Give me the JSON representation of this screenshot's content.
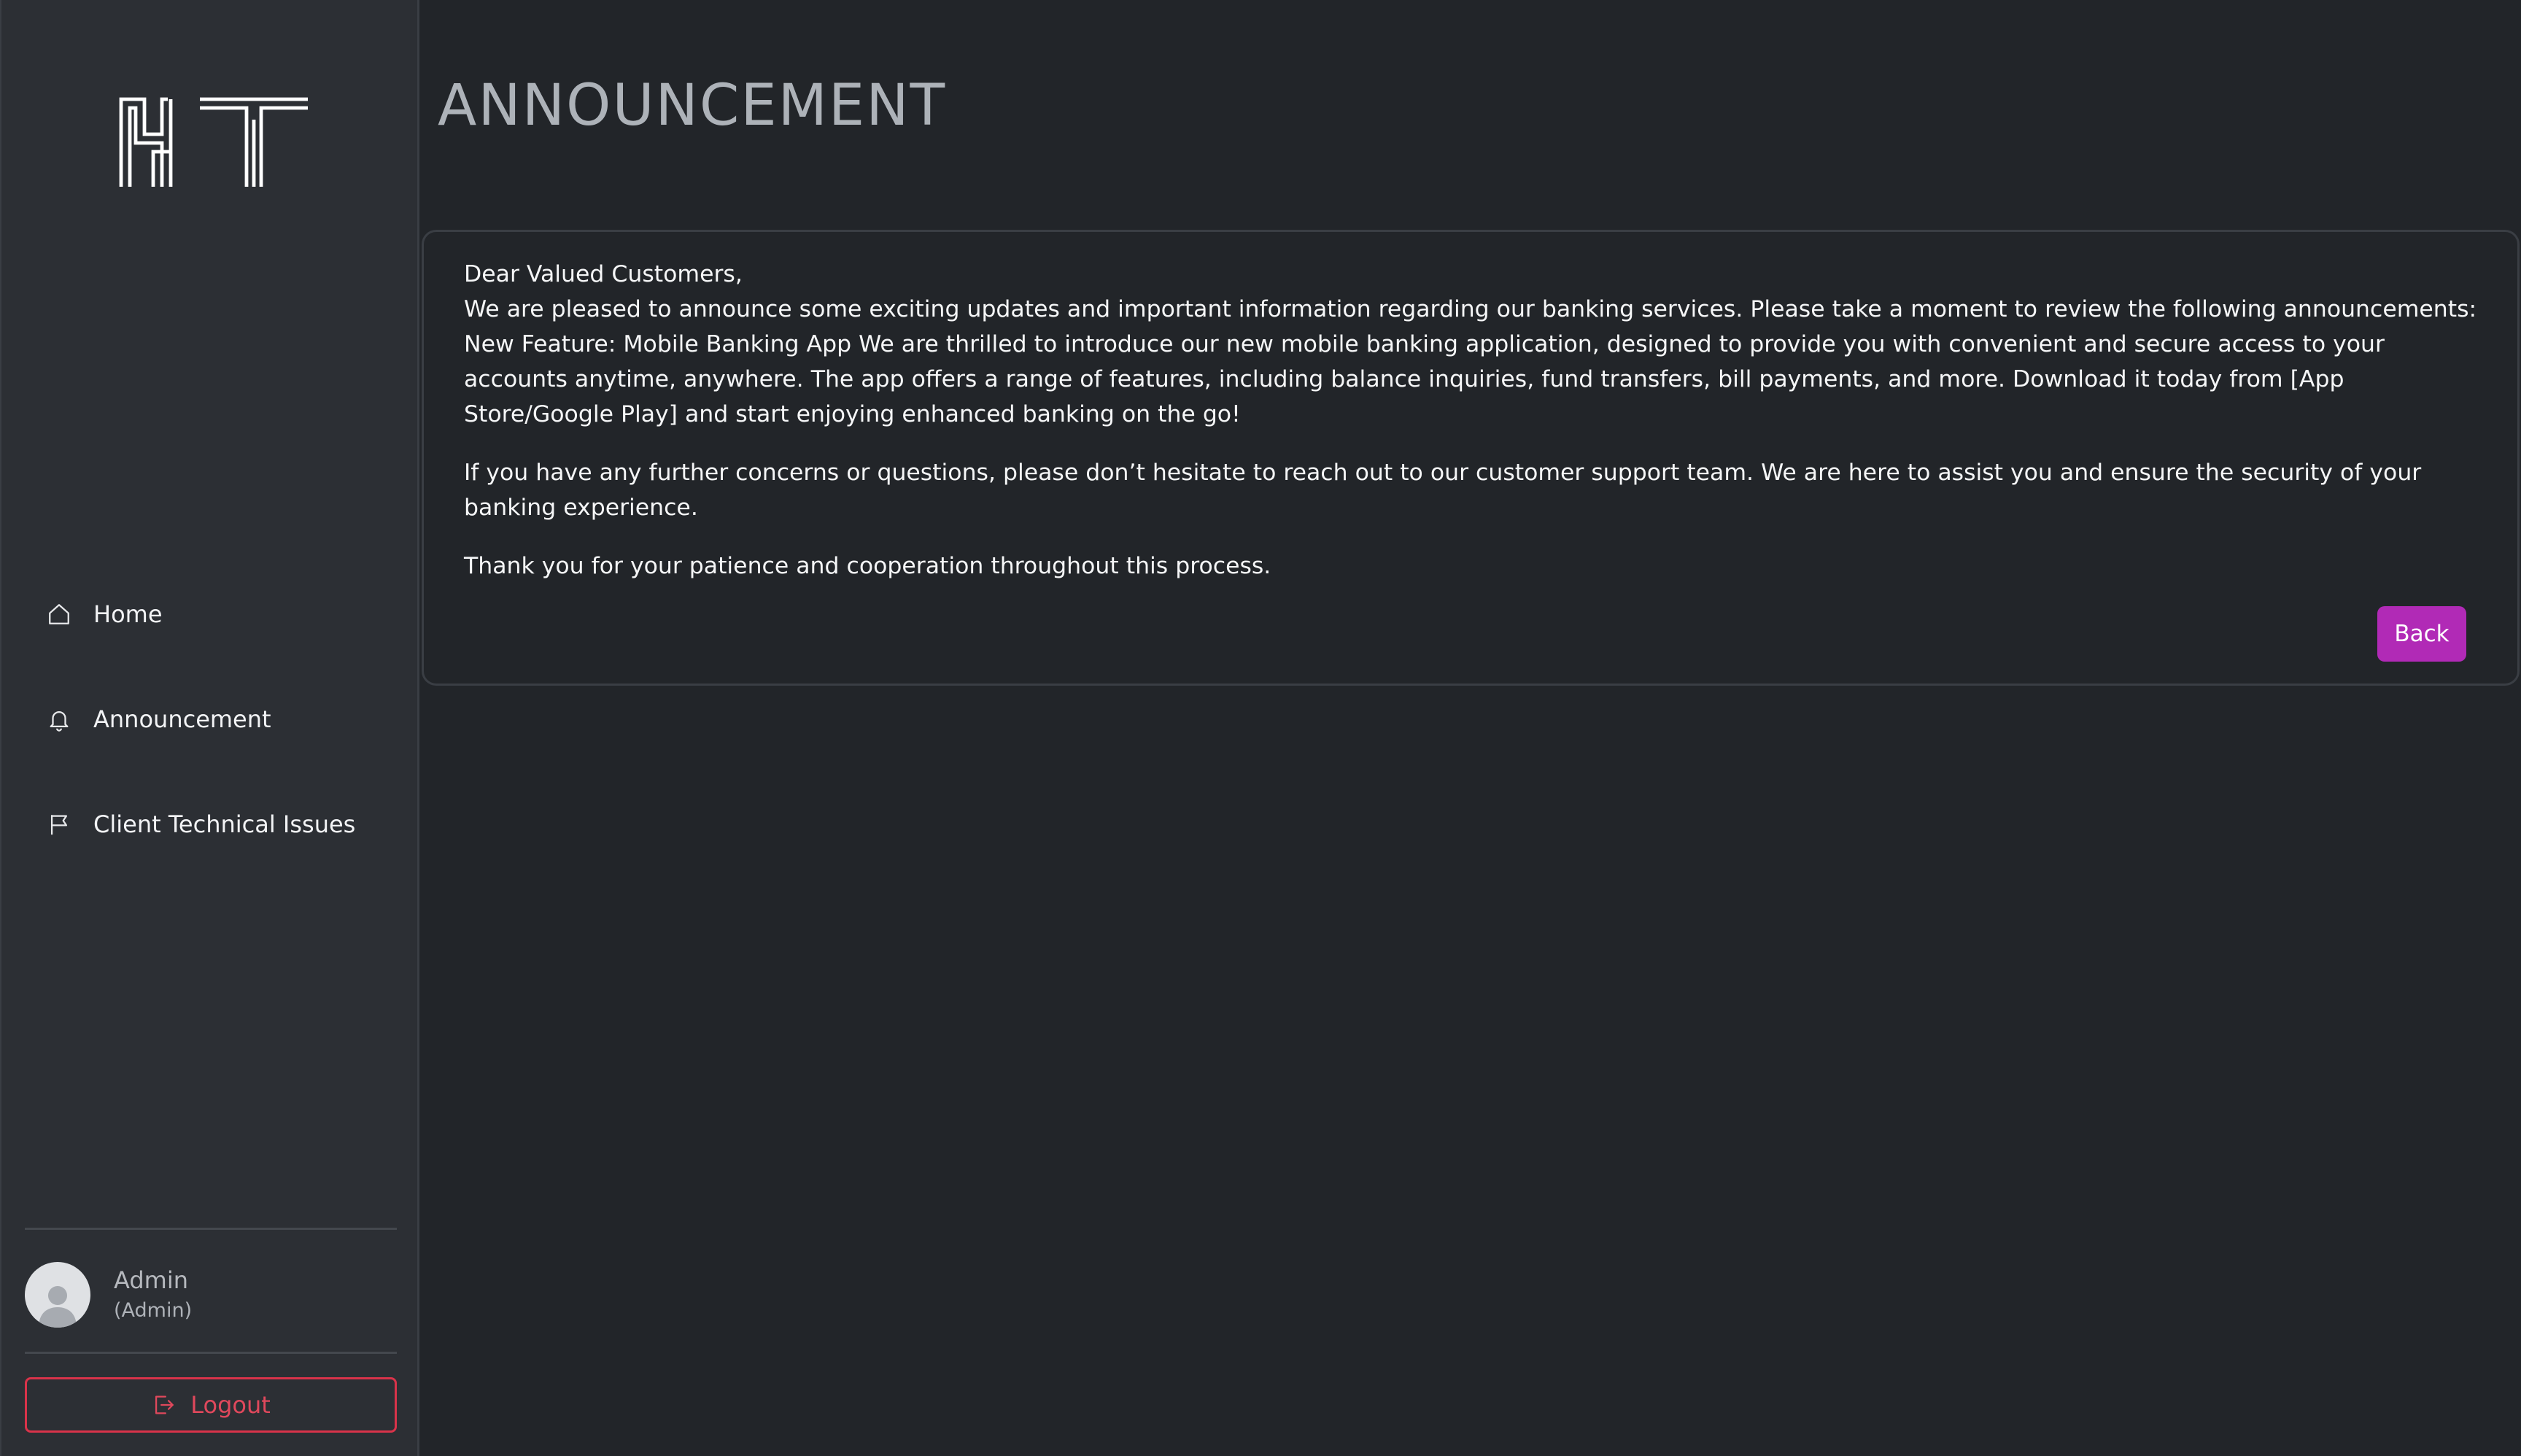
{
  "sidebar": {
    "logo_alt": "NT",
    "nav": [
      {
        "label": "Home",
        "icon": "home-icon"
      },
      {
        "label": "Announcement",
        "icon": "bell-icon"
      },
      {
        "label": "Client Technical Issues",
        "icon": "flag-icon"
      }
    ],
    "user": {
      "name": "Admin",
      "role": "(Admin)"
    },
    "logout_label": "Logout"
  },
  "main": {
    "title": "ANNOUNCEMENT",
    "announcement": {
      "greeting": "Dear Valued Customers,",
      "body": "We are pleased to announce some exciting updates and important information regarding our banking services. Please take a moment to review the following announcements: New Feature: Mobile Banking App We are thrilled to introduce our new mobile banking application, designed to provide you with convenient and secure access to your accounts anytime, anywhere. The app offers a range of features, including balance inquiries, fund transfers, bill payments, and more. Download it today from [App Store/Google Play] and start enjoying enhanced banking on the go!",
      "support": "If you have any further concerns or questions, please don’t hesitate to reach out to our customer support team. We are here to assist you and ensure the security of your banking experience.",
      "closing": "Thank you for your patience and cooperation throughout this process."
    },
    "back_label": "Back"
  },
  "colors": {
    "background": "#222529",
    "sidebar": "#2c2f34",
    "accent": "#b12ab6",
    "danger": "#d9334a"
  }
}
